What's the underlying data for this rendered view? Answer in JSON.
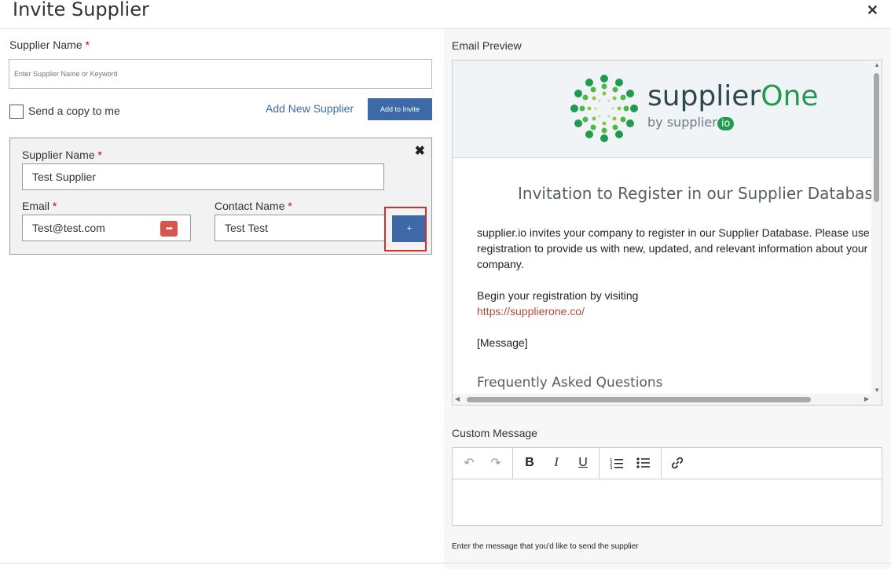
{
  "dialog": {
    "title": "Invite Supplier"
  },
  "left": {
    "supplier_name_label": "Supplier Name",
    "required_mark": "*",
    "search_placeholder": "Enter Supplier Name or Keyword",
    "send_copy_label": "Send a copy to me",
    "add_new_supplier_label": "Add New Supplier",
    "add_to_invite_label": "Add to Invite",
    "card": {
      "supplier_name_label": "Supplier Name",
      "supplier_name_value": "Test Supplier",
      "email_label": "Email",
      "email_value": "Test@test.com",
      "contact_label": "Contact Name",
      "contact_value": "Test Test",
      "plus_label": "+",
      "close_glyph": "✖"
    }
  },
  "preview": {
    "label": "Email Preview",
    "logo_supplier": "supplier",
    "logo_one": "One",
    "logo_by": "by supplier",
    "logo_io": "io",
    "heading": "Invitation to Register in our Supplier Database",
    "paragraph1": "supplier.io invites your company to register in our Supplier Database. Please use registration to provide us with new, updated, and relevant information about your company.",
    "paragraph2": "Begin your registration by visiting",
    "link": "https://supplierone.co/",
    "placeholder": "[Message]",
    "faq": "Frequently Asked Questions"
  },
  "custom_message": {
    "label": "Custom Message",
    "toolbar": {
      "undo": "↶",
      "redo": "↷",
      "bold": "B",
      "italic": "I",
      "underline": "U",
      "ordered_list": "⒈",
      "bullet_list": "☰",
      "link": "🔗"
    },
    "hint": "Enter the message that you'd like to send the supplier"
  },
  "colors": {
    "accent": "#3d6aa6",
    "brand_green": "#1f9a4e",
    "required": "#cc0000",
    "highlight": "#d32f2f"
  }
}
